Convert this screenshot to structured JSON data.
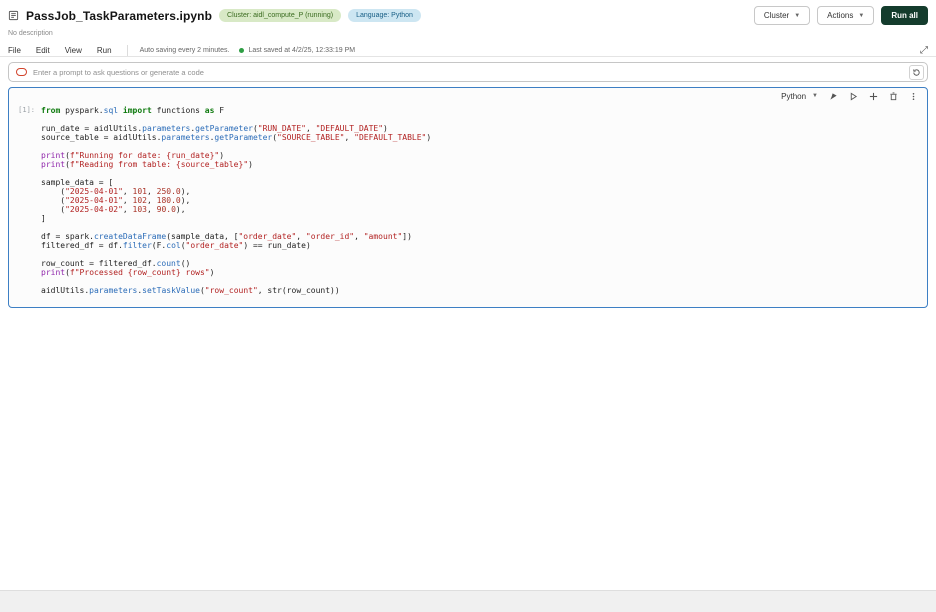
{
  "header": {
    "title": "PassJob_TaskParameters.ipynb",
    "cluster_badge": "Cluster: aidl_compute_P (running)",
    "language_badge": "Language: Python",
    "description": "No description",
    "buttons": {
      "cluster": "Cluster",
      "actions": "Actions",
      "run_all": "Run all"
    }
  },
  "menu": {
    "items": [
      "File",
      "Edit",
      "View",
      "Run"
    ],
    "autosave": "Auto saving every 2 minutes.",
    "last_saved": "Last saved at 4/2/25, 12:33:19 PM"
  },
  "assistant": {
    "placeholder": "Enter a prompt to ask questions or generate a code"
  },
  "cell": {
    "execution_label": "[1]:",
    "language": "Python",
    "code_lines": [
      "from pyspark.sql import functions as F",
      "",
      "run_date = aidlUtils.parameters.getParameter(\"RUN_DATE\", \"DEFAULT_DATE\")",
      "source_table = aidlUtils.parameters.getParameter(\"SOURCE_TABLE\", \"DEFAULT_TABLE\")",
      "",
      "print(f\"Running for date: {run_date}\")",
      "print(f\"Reading from table: {source_table}\")",
      "",
      "sample_data = [",
      "    (\"2025-04-01\", 101, 250.0),",
      "    (\"2025-04-01\", 102, 180.0),",
      "    (\"2025-04-02\", 103, 90.0),",
      "]",
      "",
      "df = spark.createDataFrame(sample_data, [\"order_date\", \"order_id\", \"amount\"])",
      "filtered_df = df.filter(F.col(\"order_date\") == run_date)",
      "",
      "row_count = filtered_df.count()",
      "print(f\"Processed {row_count} rows\")",
      "",
      "aidlUtils.parameters.setTaskValue(\"row_count\", str(row_count))"
    ]
  },
  "colors": {
    "accent-border": "#3d7fc4",
    "badge-green-bg": "#d8e9c6",
    "badge-green-text": "#3a6b1f",
    "badge-blue-bg": "#cde6f2",
    "badge-blue-text": "#175e85",
    "run-all-bg": "#143c2d",
    "saved-dot": "#2e9e44",
    "assistant-icon": "#d2442c",
    "syntax-keyword": "#0e7a0e",
    "syntax-builtin": "#8e24aa",
    "syntax-string": "#b22222",
    "syntax-number": "#a93226",
    "syntax-function": "#2b6cb8"
  }
}
